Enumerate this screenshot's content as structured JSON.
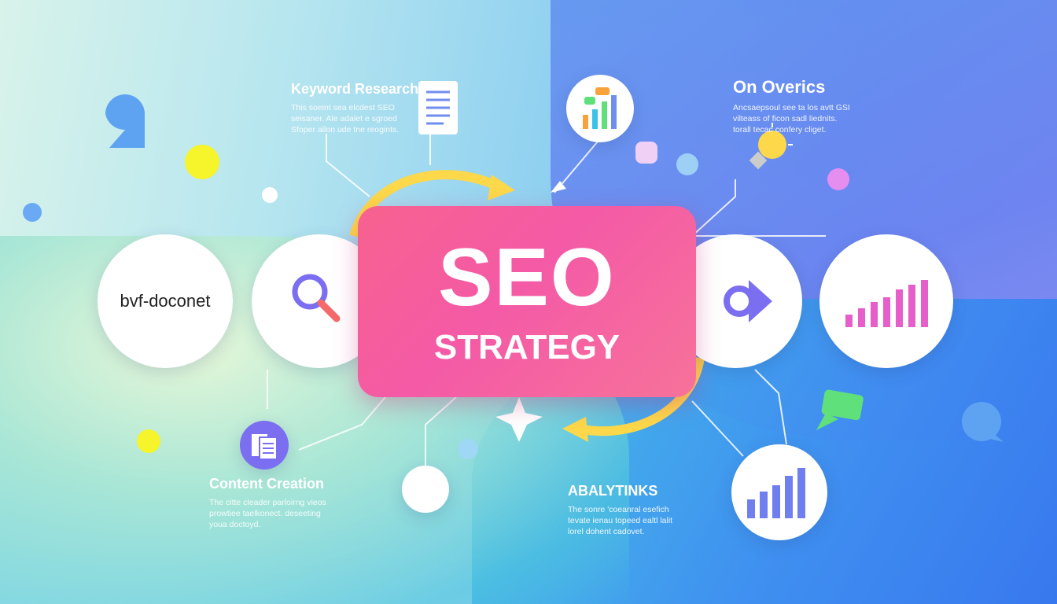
{
  "center": {
    "title": "SEO",
    "subtitle": "STRATEGY"
  },
  "nodes": [
    {
      "label": "bvf-doconet",
      "icon": "text-node"
    },
    {
      "icon": "magnifier-icon"
    },
    {
      "icon": "arrow-right-icon"
    },
    {
      "icon": "bar-chart-icon"
    },
    {
      "icon": "bar-chart-icon"
    }
  ],
  "sections": {
    "keyword": {
      "title": "Keyword Research",
      "desc": "This soeint sea elcdest SEO seisaner. Ale adalet e sgroed Sfoper allon ude tne reogints."
    },
    "overics": {
      "title": "On Overics",
      "desc": "Ancsaepsoul see ta los avtt GSI vilteass of ficon sadl liednits. torall tecac confery cliget."
    },
    "content": {
      "title": "Content Creation",
      "desc": "The citte cleader parloirng vieos prowtiee taelkonect. deseeting youa doctoyd."
    },
    "analytics": {
      "title": "ABALYTINKS",
      "desc": "The sonre 'coeanral esefich tevate ienau topeed ealtl lalit lorel dohent cadovet."
    }
  },
  "colors": {
    "accent_pink": "#f45aa6",
    "arrow_yellow": "#fcd84a",
    "purple": "#7b6ef0",
    "bar_pink": "#e55ec9"
  }
}
